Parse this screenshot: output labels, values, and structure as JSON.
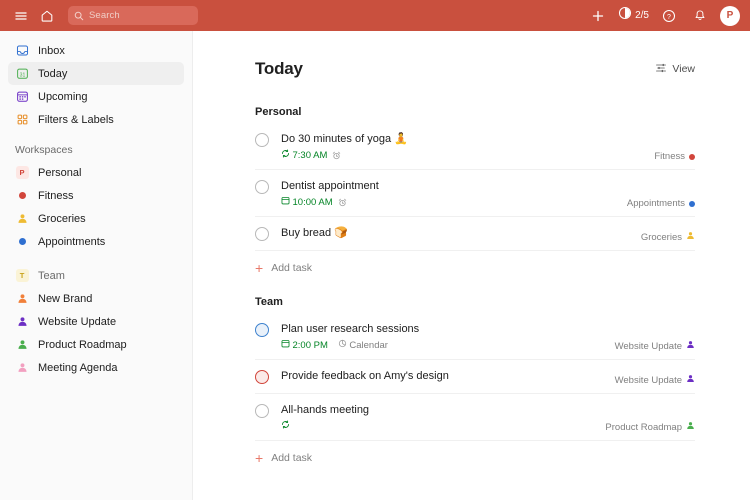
{
  "colors": {
    "brand_red": "#C9503E",
    "search_bg": "#D9695A",
    "sidebar_bg": "#FAFAFA",
    "active_item": "#EFEFEF",
    "date_green": "#058527",
    "add_task_red": "#E8796A",
    "priority_blue": "#3E82CE",
    "priority_red": "#D1453B"
  },
  "topbar": {
    "menu_icon": "hamburger-menu-icon",
    "home_icon": "home-icon",
    "search": {
      "placeholder": "Search",
      "value": "",
      "icon": "search-icon"
    },
    "add_icon": "plus-icon",
    "karma": {
      "icon": "productivity-circle-icon",
      "count": "2/5"
    },
    "help_icon": "help-question-icon",
    "notifications_icon": "bell-icon",
    "avatar": {
      "initial": "P",
      "name": "avatar"
    }
  },
  "sidebar": {
    "nav": [
      {
        "label": "Inbox",
        "icon": "inbox-icon",
        "active": false
      },
      {
        "label": "Today",
        "icon": "today-calendar-icon",
        "active": true
      },
      {
        "label": "Upcoming",
        "icon": "upcoming-calendar-icon",
        "active": false
      },
      {
        "label": "Filters & Labels",
        "icon": "filters-labels-grid-icon",
        "active": false
      }
    ],
    "workspaces_header": "Workspaces",
    "workspaces": [
      {
        "label": "Personal",
        "icon": "workspace-badge-p",
        "badge": "P",
        "badge_bg": "#FDE7E4",
        "badge_fg": "#D1453B"
      },
      {
        "label": "Fitness",
        "icon": "project-dot-red",
        "dot": "#D1453B"
      },
      {
        "label": "Groceries",
        "icon": "project-person-yellow",
        "person": "#EEBB33"
      },
      {
        "label": "Appointments",
        "icon": "project-dot-blue",
        "dot": "#2F6FD0"
      }
    ],
    "team_header": {
      "label": "Team",
      "badge": "T",
      "badge_bg": "#FAF3D6",
      "badge_fg": "#C8A21A"
    },
    "team_projects": [
      {
        "label": "New Brand",
        "icon": "project-person-orange",
        "person": "#F1803A"
      },
      {
        "label": "Website Update",
        "icon": "project-person-purple",
        "person": "#6C2FC4"
      },
      {
        "label": "Product Roadmap",
        "icon": "project-person-green",
        "person": "#4AAE4E"
      },
      {
        "label": "Meeting Agenda",
        "icon": "project-person-pink",
        "person": "#F2A0C0"
      }
    ]
  },
  "main": {
    "title": "Today",
    "view_button": {
      "label": "View",
      "icon": "sliders-icon"
    },
    "sections": [
      {
        "title": "Personal",
        "add_task_label": "Add task",
        "tasks": [
          {
            "title": "Do 30 minutes of yoga 🧘",
            "checkbox_color": "#b8b8b8",
            "date_icon": "recurring-icon",
            "date": "7:30 AM",
            "reminder_icon": "alarm-clock-icon",
            "label": "",
            "project": "Fitness",
            "project_icon": "project-dot-red",
            "project_dot": "#D1453B"
          },
          {
            "title": "Dentist appointment",
            "checkbox_color": "#b8b8b8",
            "date_icon": "calendar-icon",
            "date": "10:00 AM",
            "reminder_icon": "alarm-clock-icon",
            "label": "",
            "project": "Appointments",
            "project_icon": "project-dot-blue",
            "project_dot": "#2F6FD0"
          },
          {
            "title": "Buy bread 🍞",
            "checkbox_color": "#b8b8b8",
            "date_icon": "",
            "date": "",
            "reminder_icon": "",
            "label": "",
            "project": "Groceries",
            "project_icon": "project-person-yellow",
            "project_person": "#EEBB33"
          }
        ]
      },
      {
        "title": "Team",
        "add_task_label": "Add task",
        "tasks": [
          {
            "title": "Plan user research sessions",
            "checkbox_color": "#3E82CE",
            "checkbox_fill": "#E9F1FA",
            "date_icon": "calendar-icon",
            "date": "2:00 PM",
            "reminder_icon": "",
            "label_icon": "label-tag-icon",
            "label": "Calendar",
            "project": "Website Update",
            "project_icon": "project-person-purple",
            "project_person": "#6C2FC4"
          },
          {
            "title": "Provide feedback on Amy's design",
            "checkbox_color": "#D1453B",
            "checkbox_fill": "#FBEAE8",
            "date_icon": "",
            "date": "",
            "reminder_icon": "",
            "label": "",
            "project": "Website Update",
            "project_icon": "project-person-purple",
            "project_person": "#6C2FC4"
          },
          {
            "title": "All-hands meeting",
            "checkbox_color": "#b8b8b8",
            "date_icon": "recurring-icon",
            "date": "",
            "reminder_icon": "",
            "label": "",
            "project": "Product Roadmap",
            "project_icon": "project-person-green",
            "project_person": "#4AAE4E"
          }
        ]
      }
    ]
  }
}
